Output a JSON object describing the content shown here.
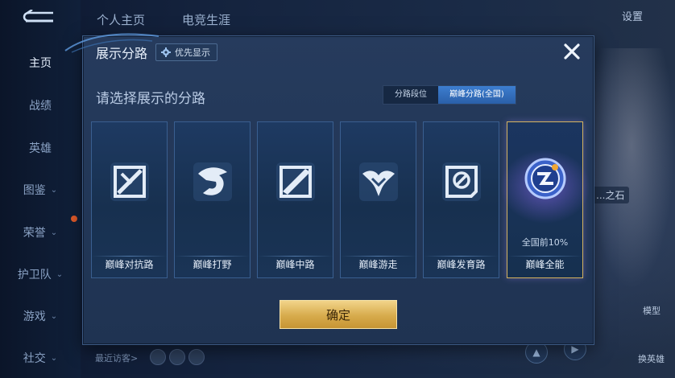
{
  "background": {
    "top_tabs": [
      "个人主页",
      "电竞生涯"
    ],
    "settings_label": "设置",
    "nav_items": [
      {
        "label": "主页",
        "chevron": false,
        "active": true
      },
      {
        "label": "战绩",
        "chevron": false,
        "active": false
      },
      {
        "label": "英雄",
        "chevron": false,
        "active": false
      },
      {
        "label": "图鉴",
        "chevron": true,
        "active": false
      },
      {
        "label": "荣誉",
        "chevron": true,
        "active": false
      },
      {
        "label": "护卫队",
        "chevron": true,
        "active": false
      },
      {
        "label": "游戏",
        "chevron": true,
        "active": false
      },
      {
        "label": "社交",
        "chevron": true,
        "active": false
      }
    ],
    "recent_visitors_label": "最近访客>",
    "model_label": "模型",
    "change_hero_label": "换英雄",
    "side_tag": "...之石"
  },
  "modal": {
    "title": "展示分路",
    "priority_button": "优先显示",
    "subtitle": "请选择展示的分路",
    "segments": [
      {
        "label": "分路段位",
        "active": false
      },
      {
        "label": "巅峰分路(全国)",
        "active": true
      }
    ],
    "cards": [
      {
        "label": "巅峰对抗路",
        "icon": "clash-lane-icon",
        "selected": false
      },
      {
        "label": "巅峰打野",
        "icon": "jungle-icon",
        "selected": false
      },
      {
        "label": "巅峰中路",
        "icon": "mid-lane-icon",
        "selected": false
      },
      {
        "label": "巅峰游走",
        "icon": "roam-icon",
        "selected": false
      },
      {
        "label": "巅峰发育路",
        "icon": "farm-lane-icon",
        "selected": false
      },
      {
        "label": "巅峰全能",
        "icon": "all-round-icon",
        "selected": true,
        "rank": "全国前10%"
      }
    ],
    "confirm_label": "确定"
  },
  "colors": {
    "accent_blue": "#3d7ed0",
    "gold_button": "#d7ab4c",
    "selected_border": "#d6b45e"
  }
}
